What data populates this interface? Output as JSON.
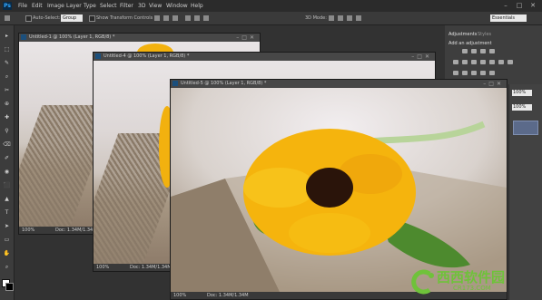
{
  "app": {
    "logo": "Ps"
  },
  "menu": [
    "File",
    "Edit",
    "Image",
    "Layer",
    "Type",
    "Select",
    "Filter",
    "3D",
    "View",
    "Window",
    "Help"
  ],
  "window_controls": [
    "–",
    "□",
    "✕"
  ],
  "options_bar": {
    "auto_select_label": "Auto-Select:",
    "auto_select_value": "Group",
    "transform_label": "Show Transform Controls",
    "mode_label": "3D Mode:",
    "workspace": "Essentials"
  },
  "tools": [
    "▸",
    "⬚",
    "✎",
    "⌕",
    "✂",
    "⊕",
    "✚",
    "⚲",
    "⌫",
    "✐",
    "◉",
    "⬛",
    "▲",
    "T",
    "➤",
    "▭",
    "✋",
    "⌕"
  ],
  "right_panel": {
    "tabs": [
      "Adjustments",
      "Styles"
    ],
    "add_adjustment": "Add an adjustment",
    "zoom_values": [
      "100%",
      "100%"
    ]
  },
  "documents": [
    {
      "title": "Untitled-1 @ 100% (Layer 1, RGB/8) *",
      "zoom": "100%",
      "doc": "Doc: 1.34M/1.34M"
    },
    {
      "title": "Untitled-4 @ 100% (Layer 1, RGB/8) *",
      "zoom": "100%",
      "doc": "Doc: 1.34M/1.34M"
    },
    {
      "title": "Untitled-5 @ 100% (Layer 1, RGB/8) *",
      "zoom": "100%",
      "doc": "Doc: 1.34M/1.34M"
    }
  ],
  "watermark": {
    "title": "西西软件园",
    "subtitle": "CR173.COM"
  },
  "colors": {
    "accent": "#31a8ff",
    "watermark": "#6fc23a"
  }
}
